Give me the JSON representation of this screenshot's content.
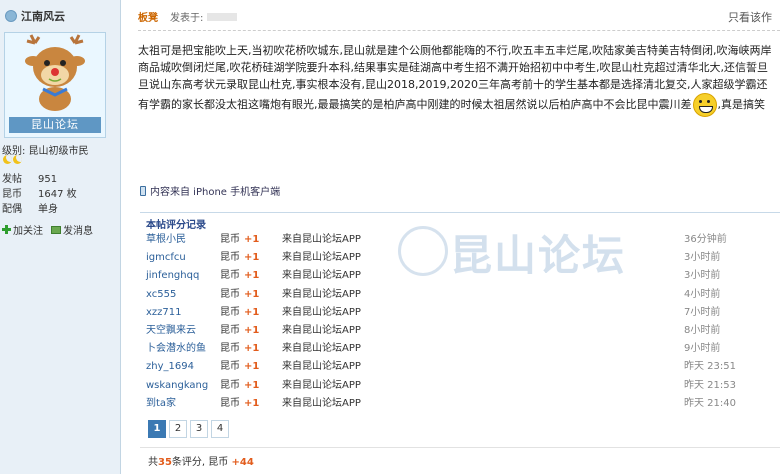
{
  "sidebar": {
    "username": "江南风云",
    "avatar_banner": "昆山论坛",
    "level": "级别: 昆山初级市民",
    "stats": [
      {
        "key": "发帖",
        "value": "951"
      },
      {
        "key": "昆币",
        "value": "1647 枚"
      },
      {
        "key": "配偶",
        "value": "单身"
      }
    ],
    "actions": {
      "follow": "加关注",
      "message": "发消息"
    }
  },
  "header": {
    "op_badge": "板凳",
    "posted_label": "发表于:",
    "only_author": "只看该作"
  },
  "post": {
    "text_main": "太祖可是把宝能吹上天,当初吹花桥吹城东,昆山就是建个公厕他都能嗨的不行,吹五丰五丰烂尾,吹陆家美吉特美吉特倒闭,吹海峡两岸商品城吹倒闭烂尾,吹花桥硅湖学院要升本科,结果事实是硅湖高中考生招不满开始招初中中考生,吹昆山杜克超过清华北大,还信誓旦旦说山东高考状元录取昆山杜克,事实根本没有,昆山2018,2019,2020三年高考前十的学生基本都是选择清北复交,人家超级学霸还有学霸的家长都没太祖这嘴炮有眼光,最最搞笑的是柏庐高中刚建的时候太祖居然说以后柏庐高中不会比昆中震川差",
    "text_tail": ",真是搞笑",
    "mobile_note": "内容来自 iPhone 手机客户端"
  },
  "ratings": {
    "title": "本帖评分记录",
    "rows": [
      {
        "user": "草根小民",
        "currency": "昆币",
        "amount": "+1",
        "reason": "来自昆山论坛APP",
        "time": "36分钟前"
      },
      {
        "user": "igmcfcu",
        "currency": "昆币",
        "amount": "+1",
        "reason": "来自昆山论坛APP",
        "time": "3小时前"
      },
      {
        "user": "jinfenghqq",
        "currency": "昆币",
        "amount": "+1",
        "reason": "来自昆山论坛APP",
        "time": "3小时前"
      },
      {
        "user": "xc555",
        "currency": "昆币",
        "amount": "+1",
        "reason": "来自昆山论坛APP",
        "time": "4小时前"
      },
      {
        "user": "xzz711",
        "currency": "昆币",
        "amount": "+1",
        "reason": "来自昆山论坛APP",
        "time": "7小时前"
      },
      {
        "user": "天空飘来云",
        "currency": "昆币",
        "amount": "+1",
        "reason": "来自昆山论坛APP",
        "time": "8小时前"
      },
      {
        "user": "卜会潜水的鱼",
        "currency": "昆币",
        "amount": "+1",
        "reason": "来自昆山论坛APP",
        "time": "9小时前"
      },
      {
        "user": "zhy_1694",
        "currency": "昆币",
        "amount": "+1",
        "reason": "来自昆山论坛APP",
        "time": "昨天 23:51"
      },
      {
        "user": "wskangkang",
        "currency": "昆币",
        "amount": "+1",
        "reason": "来自昆山论坛APP",
        "time": "昨天 21:53"
      },
      {
        "user": "到ta家",
        "currency": "昆币",
        "amount": "+1",
        "reason": "来自昆山论坛APP",
        "time": "昨天 21:40"
      }
    ],
    "pages": [
      "1",
      "2",
      "3",
      "4"
    ],
    "summary_prefix": "共",
    "summary_count": "35",
    "summary_mid": "条评分,",
    "summary_currency": "昆币",
    "summary_total": "+44"
  },
  "watermark": "昆山论坛"
}
